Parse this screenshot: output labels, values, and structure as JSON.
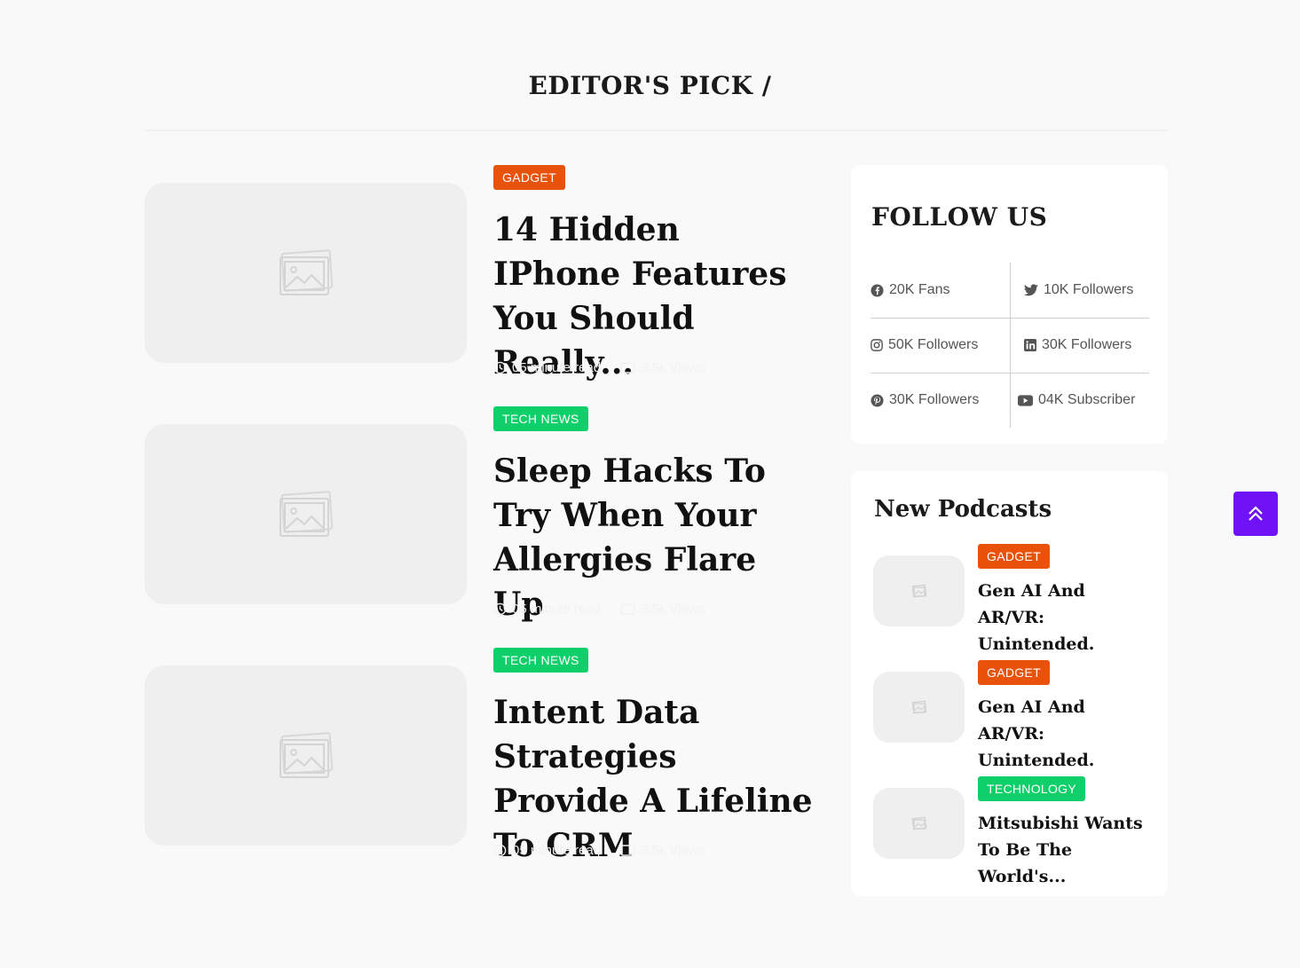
{
  "section": {
    "title": "EDITOR'S PICK /"
  },
  "posts": [
    {
      "category": "GADGET",
      "category_color": "#e8520a",
      "title": "14 Hidden IPhone Features You Should Really...",
      "read_time": "05 minute read",
      "views": "3.5k Views"
    },
    {
      "category": "TECH NEWS",
      "category_color": "#0fcf6a",
      "title": "Sleep Hacks To Try When Your Allergies Flare Up",
      "read_time": "05 minute read",
      "views": "3.5k Views"
    },
    {
      "category": "TECH NEWS",
      "category_color": "#0fcf6a",
      "title": "Intent Data Strategies Provide A Lifeline To CRM",
      "read_time": "05 minute read",
      "views": "3.5k Views"
    }
  ],
  "follow": {
    "title": "FOLLOW US",
    "items": [
      {
        "icon": "facebook-icon",
        "label": "20K Fans"
      },
      {
        "icon": "twitter-icon",
        "label": "10K Followers"
      },
      {
        "icon": "instagram-icon",
        "label": "50K Followers"
      },
      {
        "icon": "linkedin-icon",
        "label": "30K Followers"
      },
      {
        "icon": "pinterest-icon",
        "label": "30K Followers"
      },
      {
        "icon": "youtube-icon",
        "label": "04K Subscriber"
      }
    ]
  },
  "podcasts": {
    "title": "New Podcasts",
    "items": [
      {
        "category": "GADGET",
        "category_color": "#e8520a",
        "title": "Gen AI And AR/VR: Unintended."
      },
      {
        "category": "GADGET",
        "category_color": "#e8520a",
        "title": "Gen AI And AR/VR: Unintended."
      },
      {
        "category": "TECHNOLOGY",
        "category_color": "#0fcf6a",
        "title": "Mitsubishi Wants To Be The World's..."
      }
    ]
  },
  "colors": {
    "accent": "#6f12f5",
    "orange": "#e8520a",
    "green": "#0fcf6a"
  }
}
